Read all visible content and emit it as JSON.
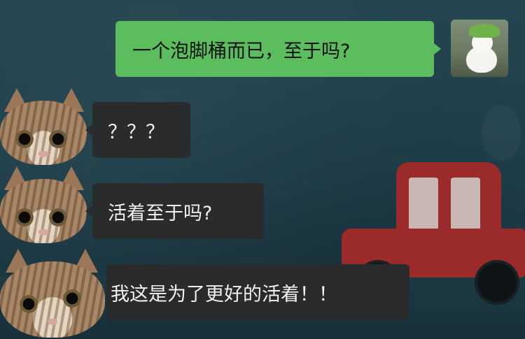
{
  "messages": [
    {
      "side": "sent",
      "text": "一个泡脚桶而已，至于吗?"
    },
    {
      "side": "received",
      "text": "？？？"
    },
    {
      "side": "received",
      "text": "活着至于吗?"
    },
    {
      "side": "received",
      "text": "我这是为了更好的活着！！"
    }
  ],
  "colors": {
    "sent_bubble": "#5bbd5e",
    "received_bubble": "#2a2b2d",
    "background": "#234450",
    "car": "#9b2a2a"
  },
  "icons": {
    "self_avatar": "rabbit-photo-avatar",
    "contact_avatar": "cat-avatar"
  }
}
